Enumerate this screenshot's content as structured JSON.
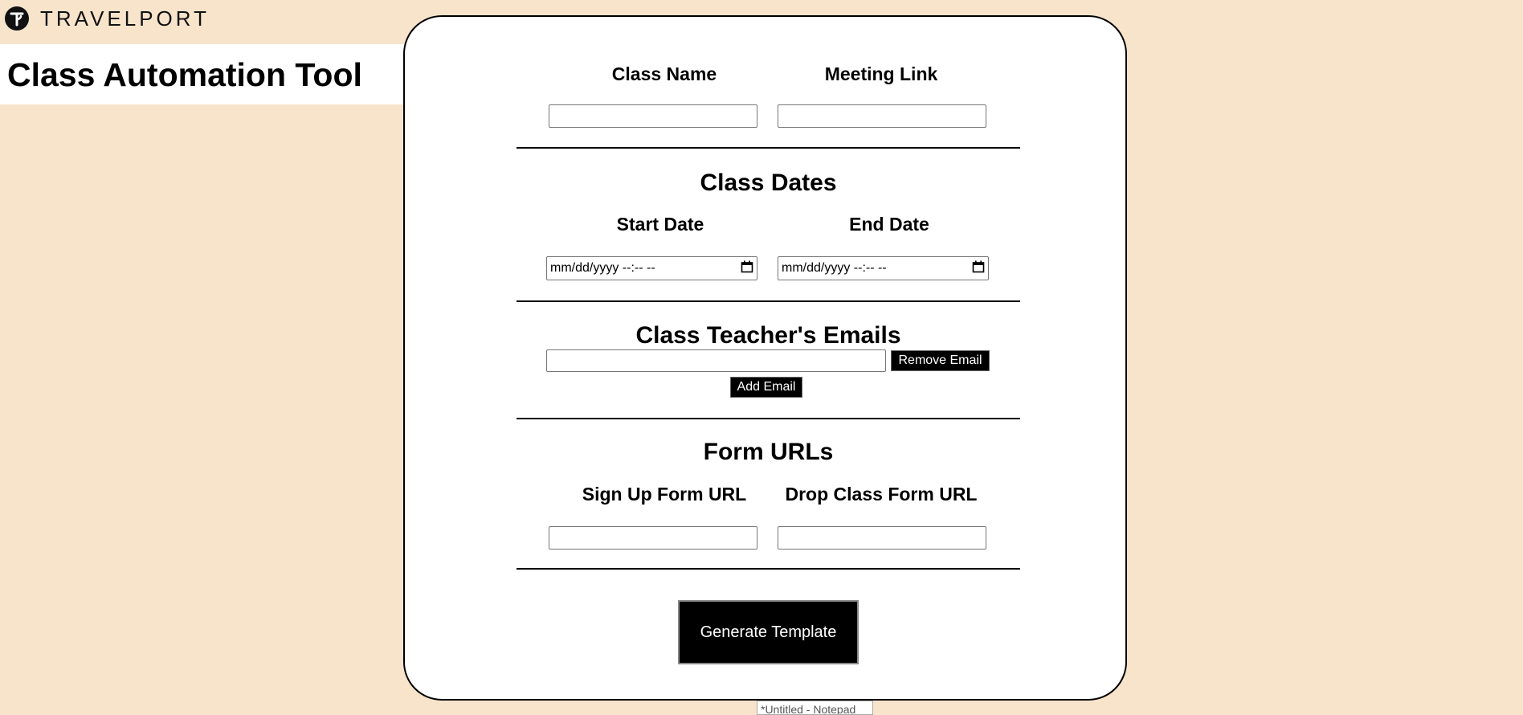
{
  "brand": {
    "logo_text": "TRAVELPORT",
    "logo_icon": "travelport-t-logo"
  },
  "page": {
    "title": "Class Automation Tool"
  },
  "form": {
    "class_name_label": "Class Name",
    "class_name_value": "",
    "meeting_link_label": "Meeting Link",
    "meeting_link_value": "",
    "dates_heading": "Class Dates",
    "start_date_label": "Start Date",
    "start_date_placeholder": "mm/dd/yyyy --:-- --",
    "end_date_label": "End Date",
    "end_date_placeholder": "mm/dd/yyyy --:-- --",
    "emails_heading": "Class Teacher's Emails",
    "email_value": "",
    "remove_email_label": "Remove Email",
    "add_email_label": "Add Email",
    "urls_heading": "Form URLs",
    "signup_url_label": "Sign Up Form URL",
    "signup_url_value": "",
    "drop_url_label": "Drop Class Form URL",
    "drop_url_value": "",
    "generate_label": "Generate Template"
  },
  "taskbar": {
    "tooltip": "*Untitled - Notepad"
  },
  "colors": {
    "background": "#f8e4cb",
    "card": "#ffffff",
    "button": "#000000"
  }
}
